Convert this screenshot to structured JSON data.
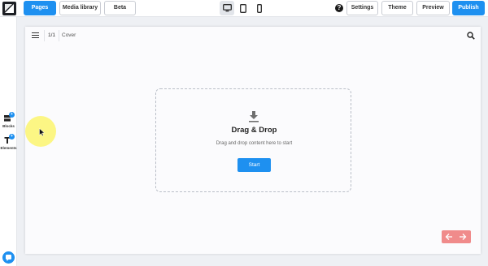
{
  "toolbar": {
    "pages_label": "Pages",
    "media_library_label": "Media library",
    "beta_label": "Beta",
    "settings_label": "Settings",
    "theme_label": "Theme",
    "preview_label": "Preview",
    "publish_label": "Publish",
    "help_glyph": "?",
    "devices": [
      {
        "name": "desktop",
        "icon": "desktop-icon",
        "active": true
      },
      {
        "name": "tablet",
        "icon": "tablet-icon",
        "active": false
      },
      {
        "name": "mobile",
        "icon": "mobile-icon",
        "active": false
      }
    ]
  },
  "sidebar": {
    "items": [
      {
        "label": "Blocks",
        "badge": "+",
        "icon": "blocks-icon"
      },
      {
        "label": "Elements",
        "badge": "+",
        "icon": "text-icon"
      }
    ],
    "chat_icon": "chat-icon"
  },
  "page": {
    "count": "1/1",
    "name": "Cover",
    "dropzone": {
      "title": "Drag & Drop",
      "subtitle": "Drag and drop content here to start",
      "button_label": "Start",
      "icon": "download-icon"
    }
  },
  "colors": {
    "accent": "#1e90f0",
    "nav_arrows": "#f08b8b",
    "cursor_highlight": "#fcf46e"
  }
}
